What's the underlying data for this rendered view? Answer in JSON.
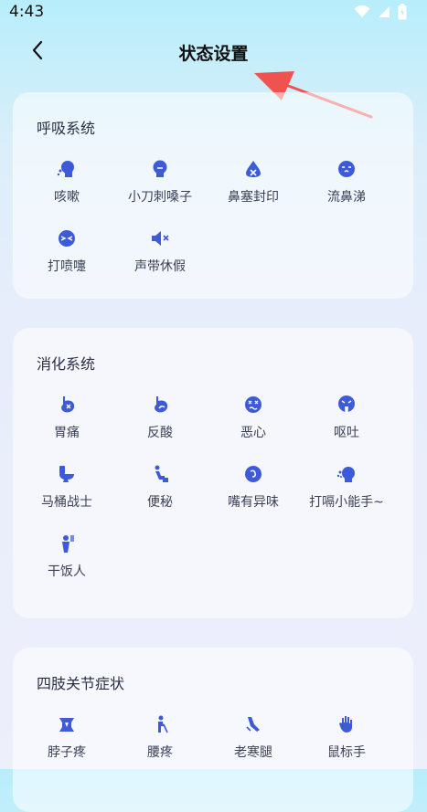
{
  "status": {
    "time": "4:43"
  },
  "header": {
    "title": "状态设置"
  },
  "sections": [
    {
      "title": "呼吸系统",
      "items": [
        {
          "label": "咳嗽",
          "icon": "cough-icon"
        },
        {
          "label": "小刀刺嗓子",
          "icon": "sore-throat-icon"
        },
        {
          "label": "鼻塞封印",
          "icon": "stuffy-nose-icon"
        },
        {
          "label": "流鼻涕",
          "icon": "runny-nose-icon"
        },
        {
          "label": "打喷嚏",
          "icon": "sneeze-icon"
        },
        {
          "label": "声带休假",
          "icon": "mute-voice-icon"
        }
      ]
    },
    {
      "title": "消化系统",
      "items": [
        {
          "label": "胃痛",
          "icon": "stomach-ache-icon"
        },
        {
          "label": "反酸",
          "icon": "acid-reflux-icon"
        },
        {
          "label": "恶心",
          "icon": "nausea-icon"
        },
        {
          "label": "呕吐",
          "icon": "vomit-icon"
        },
        {
          "label": "马桶战士",
          "icon": "toilet-icon"
        },
        {
          "label": "便秘",
          "icon": "constipation-icon"
        },
        {
          "label": "嘴有异味",
          "icon": "bad-breath-icon"
        },
        {
          "label": "打嗝小能手~",
          "icon": "burp-icon"
        },
        {
          "label": "干饭人",
          "icon": "eating-icon"
        }
      ]
    },
    {
      "title": "四肢关节症状",
      "items": [
        {
          "label": "脖子疼",
          "icon": "neck-pain-icon"
        },
        {
          "label": "腰疼",
          "icon": "back-pain-icon"
        },
        {
          "label": "老寒腿",
          "icon": "leg-ache-icon"
        },
        {
          "label": "鼠标手",
          "icon": "mouse-hand-icon"
        }
      ]
    }
  ],
  "colors": {
    "icon": "#3d5bd9",
    "arrow": "#f0534f"
  }
}
